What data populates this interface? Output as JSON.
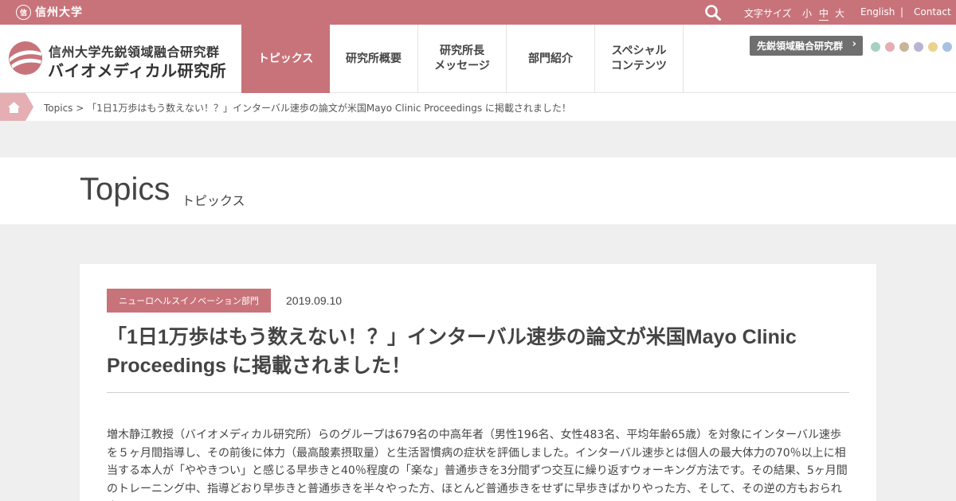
{
  "topbar": {
    "university": "信州大学",
    "emblem_glyph": "信",
    "font_size_label": "文字サイズ",
    "font_sizes": [
      "小",
      "中",
      "大"
    ],
    "english": "English",
    "separator": "|",
    "contact": "Contact"
  },
  "header": {
    "logo_line1": "信州大学先鋭領域融合研究群",
    "logo_line2": "バイオメディカル研究所",
    "nav": [
      {
        "label": "トピックス",
        "active": true
      },
      {
        "label": "研究所概要",
        "active": false
      },
      {
        "label": "研究所長\nメッセージ",
        "active": false
      },
      {
        "label": "部門紹介",
        "active": false
      },
      {
        "label": "スペシャル\nコンテンツ",
        "active": false
      }
    ],
    "cluster_button": "先鋭領域融合研究群",
    "cluster_chevron": "›",
    "dot_colors": [
      "#a8d0c0",
      "#e4aeb3",
      "#c8b498",
      "#b8b4d4",
      "#ecd08e",
      "#a6c2de"
    ]
  },
  "breadcrumb": {
    "text": "Topics > 「1日1万歩はもう数えない！？」インターバル速歩の論文が米国Mayo Clinic Proceedings に掲載されました！"
  },
  "page_title": {
    "en": "Topics",
    "ja": "トピックス"
  },
  "article": {
    "category": "ニューロヘルスイノベーション部門",
    "date": "2019.09.10",
    "title": "「1日1万歩はもう数えない！？」インターバル速歩の論文が米国Mayo Clinic Proceedings に掲載されました！",
    "body": "増木静江教授（バイオメディカル研究所）らのグループは679名の中高年者（男性196名、女性483名、平均年齢65歳）を対象にインターバル速歩を５ヶ月間指導し、その前後に体力（最高酸素摂取量）と生活習慣病の症状を評価しました。インターバル速歩とは個人の最大体力の70％以上に相当する本人が「ややきつい」と感じる早歩きと40％程度の「楽な」普通歩きを3分間ずつ交互に繰り返すウォーキング方法です。その結果、5ヶ月間のトレーニング中、指導どおり早歩きと普通歩きを半々やった方、ほとんど普通歩きをせずに早歩きばかりやった方、そして、その逆の方もおられま"
  },
  "colors": {
    "accent": "#c8737a",
    "page_bg": "#efefef"
  }
}
